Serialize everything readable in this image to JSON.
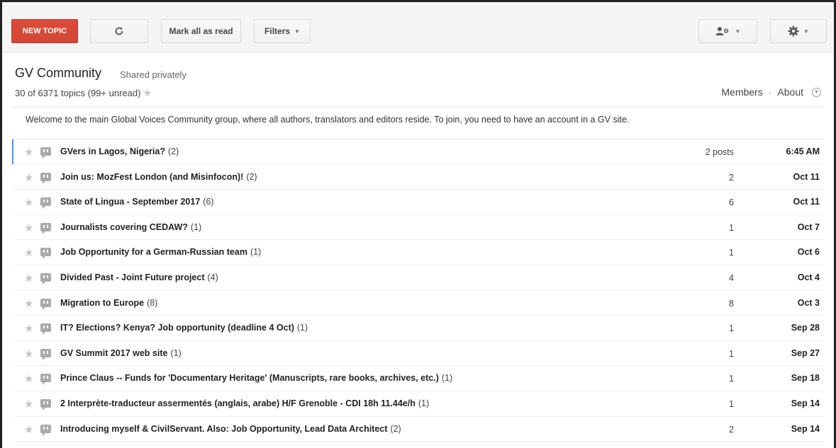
{
  "toolbar": {
    "new_topic": "NEW TOPIC",
    "mark_all_read": "Mark all as read",
    "filters": "Filters",
    "refresh_icon": "refresh-icon",
    "members_icon": "members-icon",
    "settings_icon": "gear-icon"
  },
  "header": {
    "title": "GV Community",
    "sharing": "Shared privately",
    "count": "30 of 6371 topics (99+ unread)",
    "members": "Members",
    "separator": "·",
    "about": "About",
    "welcome": "Welcome to the main Global Voices Community group, where all authors, translators and editors reside. To join, you need to have an account in a GV site."
  },
  "topics": [
    {
      "title": "GVers in Lagos, Nigeria?",
      "count": "(2)",
      "posts": "2 posts",
      "date": "6:45 AM"
    },
    {
      "title": "Join us: MozFest London (and Misinfocon)!",
      "count": "(2)",
      "posts": "2",
      "date": "Oct 11"
    },
    {
      "title": "State of Lingua - September 2017",
      "count": "(6)",
      "posts": "6",
      "date": "Oct 11"
    },
    {
      "title": "Journalists covering CEDAW?",
      "count": "(1)",
      "posts": "1",
      "date": "Oct 7"
    },
    {
      "title": "Job Opportunity for a German-Russian team",
      "count": "(1)",
      "posts": "1",
      "date": "Oct 6"
    },
    {
      "title": "Divided Past - Joint Future project",
      "count": "(4)",
      "posts": "4",
      "date": "Oct 4"
    },
    {
      "title": "Migration to Europe",
      "count": "(8)",
      "posts": "8",
      "date": "Oct 3"
    },
    {
      "title": "IT? Elections? Kenya? Job opportunity (deadline 4 Oct)",
      "count": "(1)",
      "posts": "1",
      "date": "Sep 28"
    },
    {
      "title": "GV Summit 2017 web site",
      "count": "(1)",
      "posts": "1",
      "date": "Sep 27"
    },
    {
      "title": "Prince Claus -- Funds for 'Documentary Heritage' (Manuscripts, rare books, archives, etc.)",
      "count": "(1)",
      "posts": "1",
      "date": "Sep 18"
    },
    {
      "title": "2 Interprète-traducteur assermentés (anglais, arabe) H/F Grenoble - CDI 18h 11.44e/h",
      "count": "(1)",
      "posts": "1",
      "date": "Sep 14"
    },
    {
      "title": "Introducing myself & CivilServant. Also: Job Opportunity, Lead Data Architect",
      "count": "(2)",
      "posts": "2",
      "date": "Sep 14"
    }
  ]
}
